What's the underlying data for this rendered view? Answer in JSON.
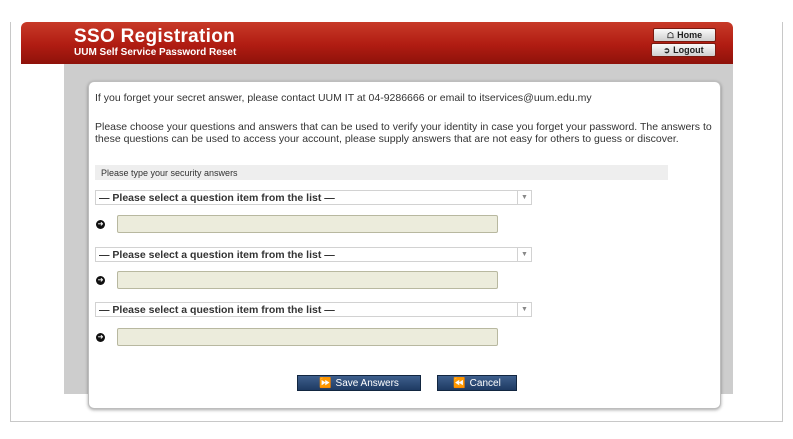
{
  "header": {
    "title": "SSO Registration",
    "subtitle": "UUM Self Service Password Reset",
    "home_label": "Home",
    "home_icon": "home-icon",
    "logout_label": "Logout",
    "logout_icon": "logout-icon",
    "brand_color": "#b01c12"
  },
  "intro": {
    "contact": "If you forget your secret answer, please contact UUM IT at 04-9286666 or email to itservices@uum.edu.my",
    "instructions": "Please choose your questions and answers that can be used to verify your identity in case you forget your password. The answers to these questions can be used to access your account, please supply answers that are not easy for others to guess or discover."
  },
  "form": {
    "section_label": "Please type your security answers",
    "questions": [
      {
        "selected": "— Please select a question item from the list —",
        "answer": ""
      },
      {
        "selected": "— Please select a question item from the list —",
        "answer": ""
      },
      {
        "selected": "— Please select a question item from the list —",
        "answer": ""
      }
    ],
    "save_label": "Save Answers",
    "cancel_label": "Cancel"
  }
}
